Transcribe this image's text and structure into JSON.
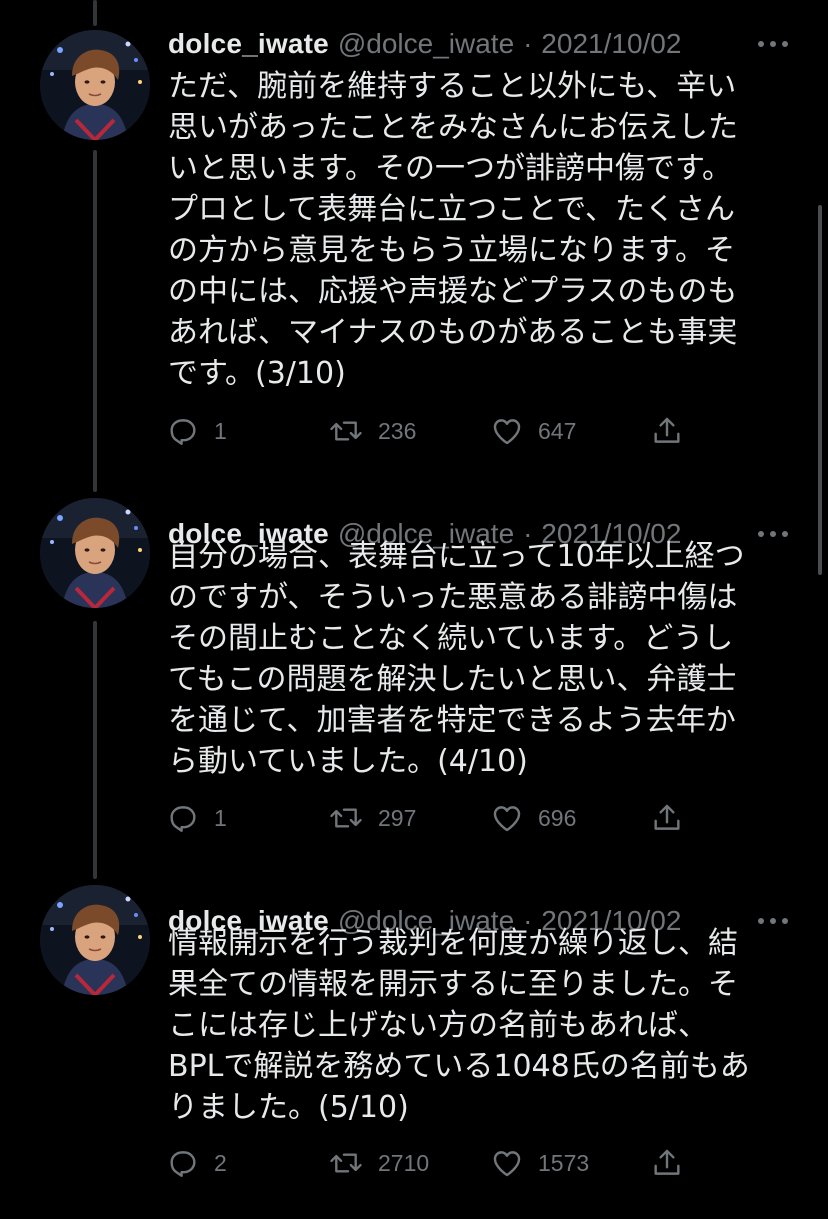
{
  "tweets": [
    {
      "display_name": "dolce_iwate",
      "handle": "@dolce_iwate",
      "separator": "·",
      "date": "2021/10/02",
      "text": "ただ、腕前を維持すること以外にも、辛い\n思いがあったことをみなさんにお伝えした\nいと思います。その一つが誹謗中傷です。\nプロとして表舞台に立つことで、たくさん\nの方から意見をもらう立場になります。そ\nの中には、応援や声援などプラスのものも\nあれば、マイナスのものがあることも事実\nです。(3/10)",
      "replies": "1",
      "retweets": "236",
      "likes": "647"
    },
    {
      "display_name": "dolce_iwate",
      "handle": "@dolce_iwate",
      "separator": "·",
      "date": "2021/10/02",
      "text": "自分の場合、表舞台に立って10年以上経つ\nのですが、そういった悪意ある誹謗中傷は\nその間止むことなく続いています。どうし\nてもこの問題を解決したいと思い、弁護士\nを通じて、加害者を特定できるよう去年か\nら動いていました。(4/10)",
      "replies": "1",
      "retweets": "297",
      "likes": "696"
    },
    {
      "display_name": "dolce_iwate",
      "handle": "@dolce_iwate",
      "separator": "·",
      "date": "2021/10/02",
      "text": "情報開示を行う裁判を何度か繰り返し、結\n果全ての情報を開示するに至りました。そ\nこには存じ上げない方の名前もあれば、\nBPLで解説を務めている1048氏の名前もあ\nりました。(5/10)",
      "replies": "2",
      "retweets": "2710",
      "likes": "1573"
    }
  ],
  "icons": {
    "more": "more-horizontal-icon",
    "reply": "reply-bubble-icon",
    "retweet": "retweet-arrows-icon",
    "like": "heart-icon",
    "share": "share-upload-icon",
    "avatar": "avatar-photo"
  },
  "colors": {
    "background": "#000000",
    "text_primary": "#e7e9ea",
    "text_secondary": "#71767b",
    "thread_line": "#333639"
  }
}
